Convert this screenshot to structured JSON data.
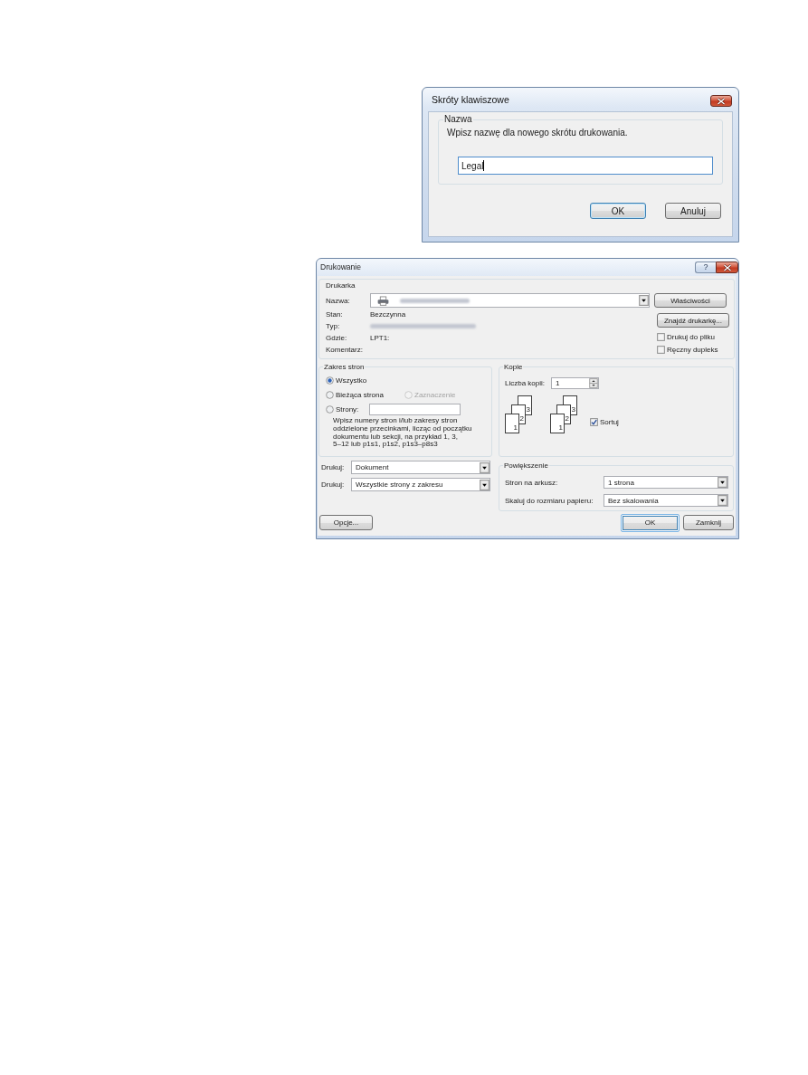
{
  "shortcut_dialog": {
    "title": "Skróty klawiszowe",
    "group_label": "Nazwa",
    "prompt": "Wpisz nazwę dla nowego skrótu drukowania.",
    "name_field": {
      "value": "Legal",
      "focused": true
    },
    "buttons": [
      {
        "label": "OK",
        "default": true
      },
      {
        "label": "Anuluj",
        "default": false
      }
    ]
  },
  "print_dialog": {
    "title": "Drukowanie",
    "help_button": "?",
    "printer": {
      "label": "Drukarka",
      "name_label": "Nazwa:",
      "name_blurred": true,
      "buttons": [
        "Właściwości",
        "Znajdź drukarkę..."
      ],
      "details": [
        {
          "label": "Stan:",
          "kind": "text",
          "value": "Bezczynna"
        },
        {
          "label": "Typ:",
          "kind": "blurred"
        },
        {
          "label": "Gdzie:",
          "kind": "text",
          "value": "LPT1:"
        },
        {
          "label": "Komentarz:",
          "kind": "text"
        }
      ],
      "checkboxes": [
        {
          "label": "Drukuj do pliku",
          "checked": false
        },
        {
          "label": "Ręczny dupleks",
          "checked": false
        }
      ]
    },
    "page_range": {
      "label": "Zakres stron",
      "rows": [
        {
          "kind": "plain",
          "options": [
            {
              "label": "Wszystko",
              "selected": true,
              "disabled": false
            }
          ]
        },
        {
          "kind": "plain",
          "options": [
            {
              "label": "Bieżąca strona",
              "selected": false,
              "disabled": false
            },
            {
              "label": "Zaznaczenie",
              "selected": false,
              "disabled": true
            }
          ]
        },
        {
          "kind": "with_field",
          "options": [
            {
              "label": "Strony:",
              "selected": false,
              "disabled": false
            }
          ]
        }
      ],
      "hint_lines": [
        "Wpisz numery stron i/lub zakresy stron",
        "oddzielone przecinkami, licząc od początku",
        "dokumentu lub sekcji, na przykład 1, 3,",
        "5–12 lub p1s1, p1s2, p1s3–p8s3"
      ]
    },
    "copies": {
      "label": "Kopie",
      "count_label": "Liczba kopii:",
      "count": "1",
      "stacks": [
        {
          "pages": [
            "3",
            "2",
            "1"
          ]
        },
        {
          "pages": [
            "3",
            "2",
            "1"
          ]
        }
      ],
      "collate": {
        "label": "Sortuj",
        "checked": true
      }
    },
    "print_what": [
      {
        "label": "Drukuj:",
        "value": "Dokument"
      },
      {
        "label": "Drukuj:",
        "value": "Wszystkie strony z zakresu"
      }
    ],
    "zoom": {
      "label": "Powiększenie",
      "rows": [
        {
          "label": "Stron na arkusz:",
          "value": "1 strona"
        },
        {
          "label": "Skaluj do rozmiaru papieru:",
          "value": "Bez skalowania"
        }
      ]
    },
    "options_button": "Opcje...",
    "buttons": [
      {
        "label": "OK",
        "default": true
      },
      {
        "label": "Zamknij",
        "default": false
      }
    ]
  }
}
